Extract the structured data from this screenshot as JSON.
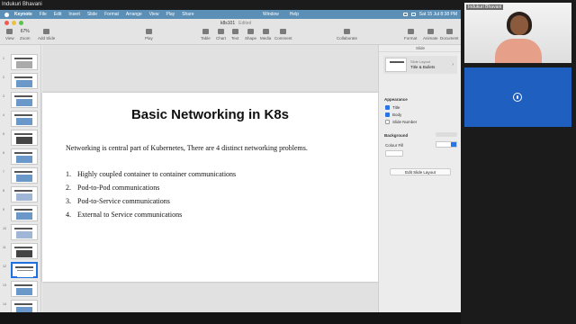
{
  "presenter": "Indukuri Bhavani",
  "menubar": {
    "app": "Keynote",
    "items": [
      "File",
      "Edit",
      "Insert",
      "Slide",
      "Format",
      "Arrange",
      "View",
      "Play",
      "Share"
    ],
    "center": [
      "Window",
      "Help"
    ],
    "clock": "Sat 15 Jul  8:38 PM"
  },
  "window": {
    "title": "k8s101",
    "status": "Edited"
  },
  "toolbar": {
    "view": "View",
    "zoom_value": "67%",
    "zoom": "Zoom",
    "add_slide": "Add Slide",
    "play": "Play",
    "table": "Table",
    "chart": "Chart",
    "text": "Text",
    "shape": "Shape",
    "media": "Media",
    "comment": "Comment",
    "collaborate": "Collaborate",
    "format": "Format",
    "animate": "Animate",
    "document": "Document"
  },
  "navigator": {
    "numbers": [
      "1",
      "2",
      "3",
      "4",
      "5",
      "6",
      "7",
      "8",
      "9",
      "10",
      "11",
      "12",
      "13",
      "14",
      "15"
    ],
    "selected": "12"
  },
  "slide": {
    "title": "Basic Networking in K8s",
    "intro": "Networking is central part of Kubernetes, There are 4 distinct networking problems.",
    "items": [
      {
        "n": "1.",
        "text": "Highly coupled container to container communications"
      },
      {
        "n": "2.",
        "text": "Pod-to-Pod communications"
      },
      {
        "n": "3.",
        "text": "Pod-to-Service communications"
      },
      {
        "n": "4.",
        "text": "External to Service communications"
      }
    ]
  },
  "inspector": {
    "header": "Slide",
    "layout_label": "Slide Layout",
    "layout_value": "Title & Bullets",
    "appearance": "Appearance",
    "title_cb": "Title",
    "body_cb": "Body",
    "slide_number_cb": "Slide Number",
    "background": "Background",
    "fill_label": "Colour Fill",
    "edit_layout": "Edit Slide Layout"
  },
  "participant": {
    "name": "Indukuri Bhavani"
  },
  "colors": {
    "menubar": "#5b8fb6",
    "selection": "#1f6fe0",
    "tile": "#1e5fbf"
  }
}
